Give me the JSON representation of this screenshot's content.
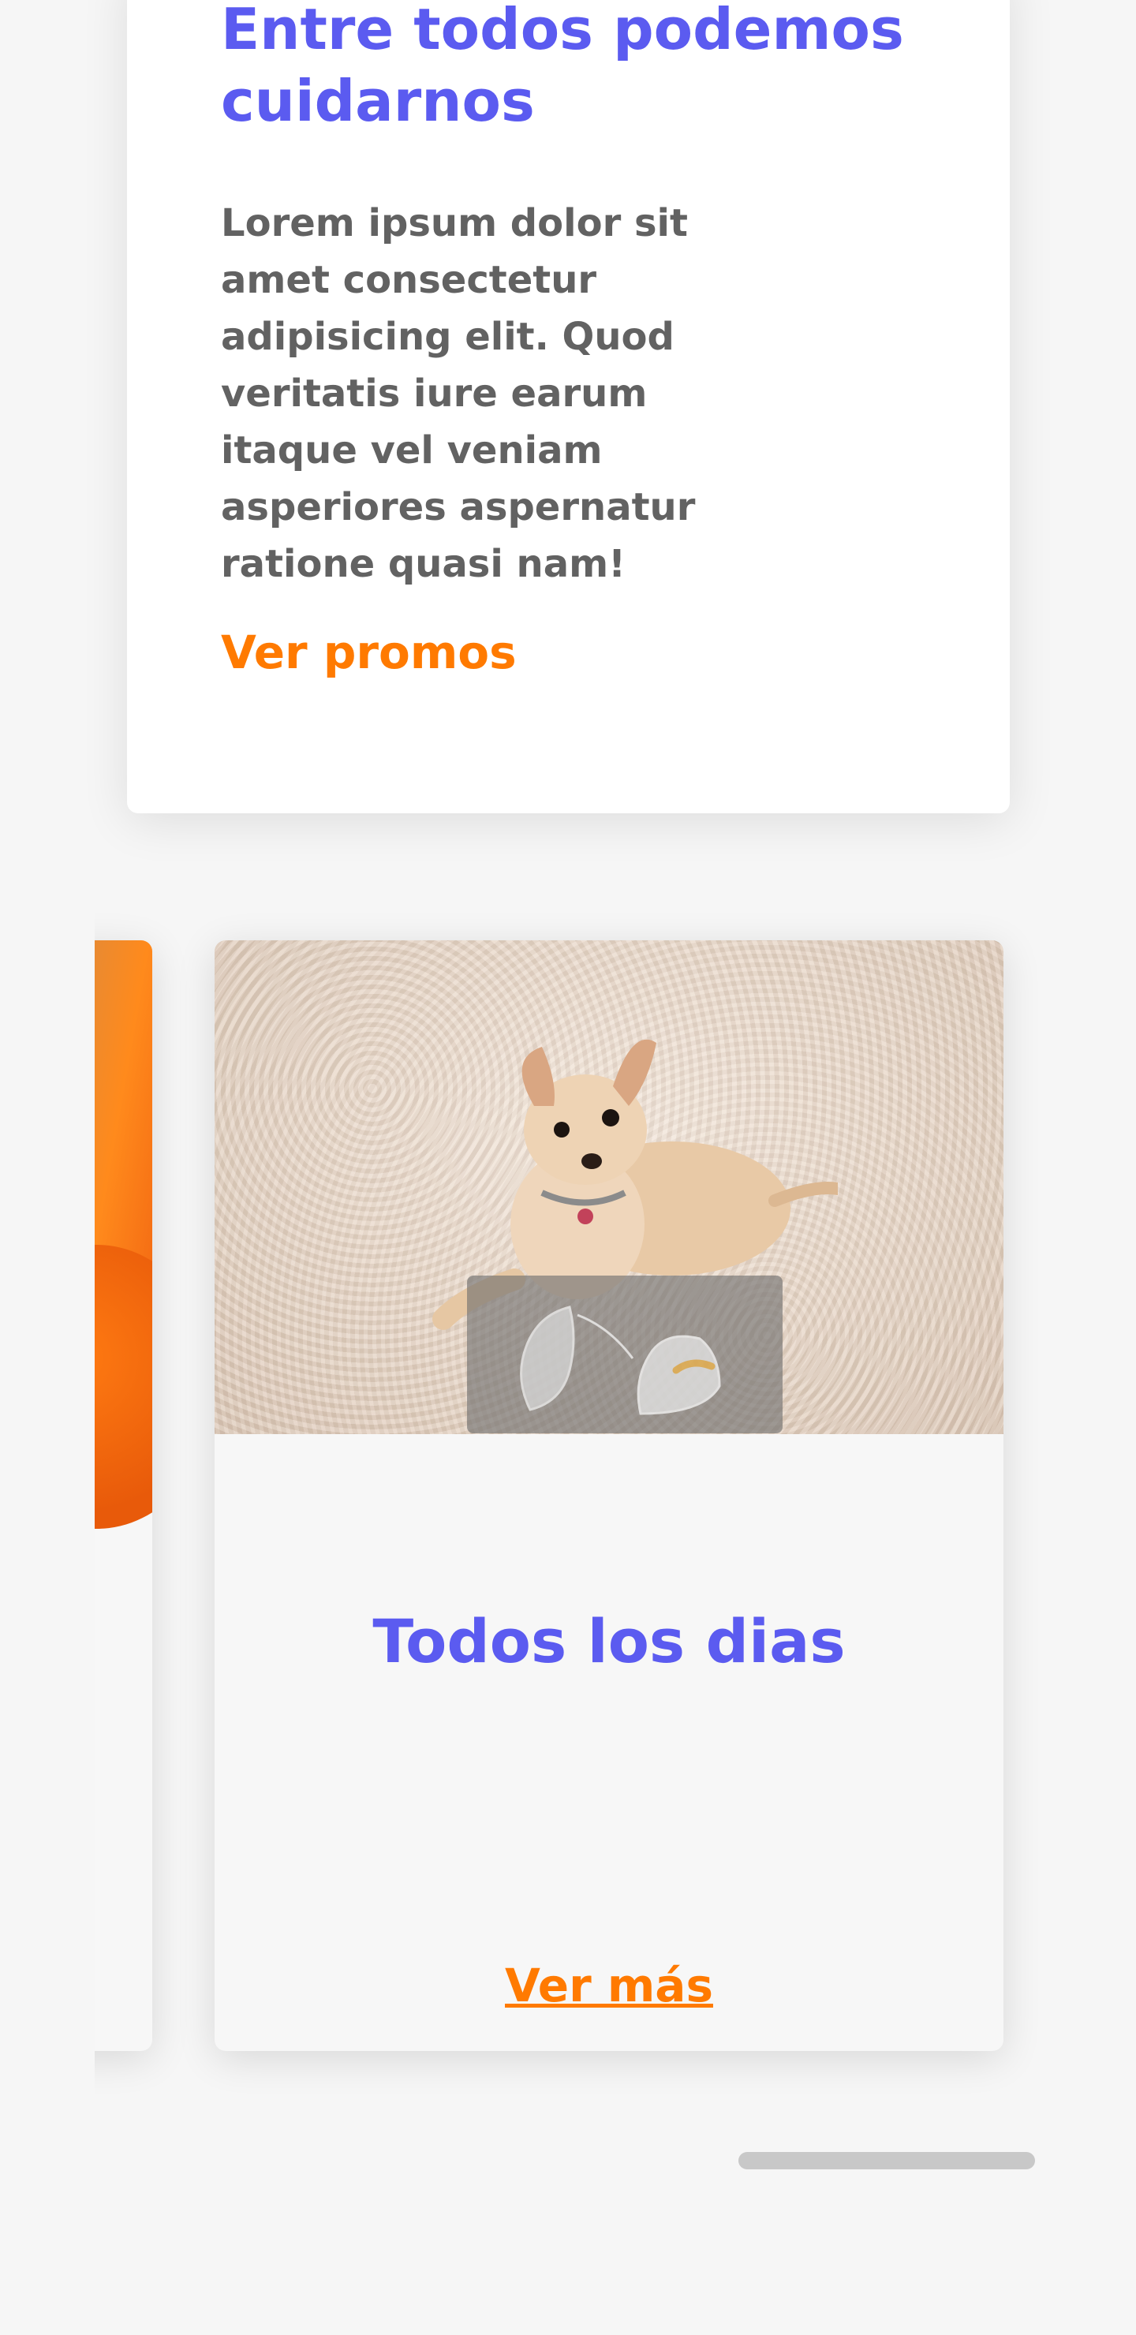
{
  "promo": {
    "title": "Entre todos podemos cuidarnos",
    "text": "Lorem ipsum dolor sit amet consectetur adipisicing elit. Quod veritatis iure earum itaque vel veniam asperiores aspernatur ratione quasi nam!",
    "link": "Ver promos"
  },
  "carousel": {
    "cards": [
      {
        "image": "orange-abstract-image"
      },
      {
        "image": "chihuahua-on-rug-photo",
        "overlay_image": "sneakers-image",
        "title": "Todos los dias",
        "link": "Ver más"
      }
    ]
  },
  "colors": {
    "title": "#5b5bf0",
    "link": "#ff7a00",
    "body_text": "#626262",
    "background": "#f6f6f6"
  }
}
